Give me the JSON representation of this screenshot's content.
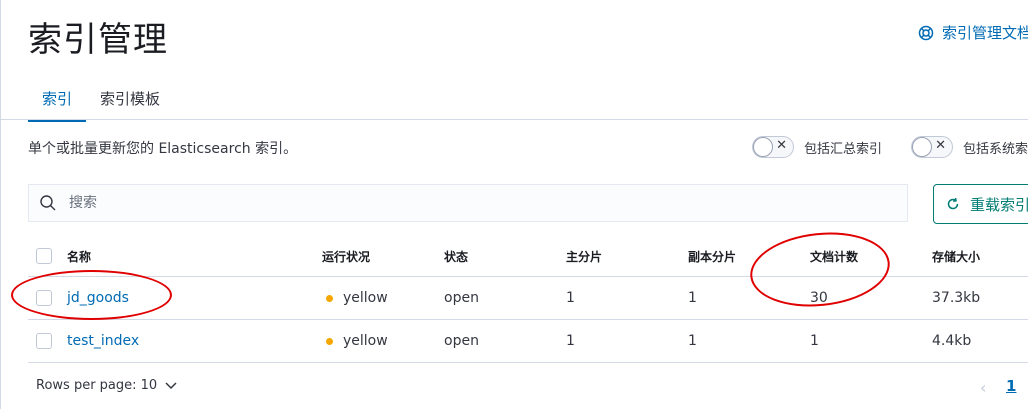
{
  "page": {
    "title": "索引管理",
    "doc_link": "索引管理文档"
  },
  "tabs": [
    {
      "label": "索引",
      "active": true
    },
    {
      "label": "索引模板",
      "active": false
    }
  ],
  "description": "单个或批量更新您的 Elasticsearch 索引。",
  "toggles": [
    {
      "label": "包括汇总索引",
      "on": false
    },
    {
      "label": "包括系统索引",
      "on": false
    }
  ],
  "search": {
    "placeholder": "搜索"
  },
  "reload_button": "重载索引",
  "table": {
    "columns": [
      "名称",
      "运行状况",
      "状态",
      "主分片",
      "副本分片",
      "文档计数",
      "存储大小"
    ],
    "rows": [
      {
        "name": "jd_goods",
        "health": "yellow",
        "status": "open",
        "primary": "1",
        "replicas": "1",
        "docs": "30",
        "size": "37.3kb"
      },
      {
        "name": "test_index",
        "health": "yellow",
        "status": "open",
        "primary": "1",
        "replicas": "1",
        "docs": "1",
        "size": "4.4kb"
      }
    ]
  },
  "pagination": {
    "rows_per_page": "Rows per page: 10",
    "prev": "‹",
    "current_page": "1"
  },
  "colors": {
    "accent": "#006bb4",
    "health_yellow": "#f5a700",
    "annotation": "#e00000",
    "reload": "#017d73"
  },
  "icons": {
    "doc_link": "help-lifebuoy-icon",
    "search": "search-icon",
    "reload": "refresh-icon",
    "rows_dropdown": "chevron-down-icon"
  }
}
